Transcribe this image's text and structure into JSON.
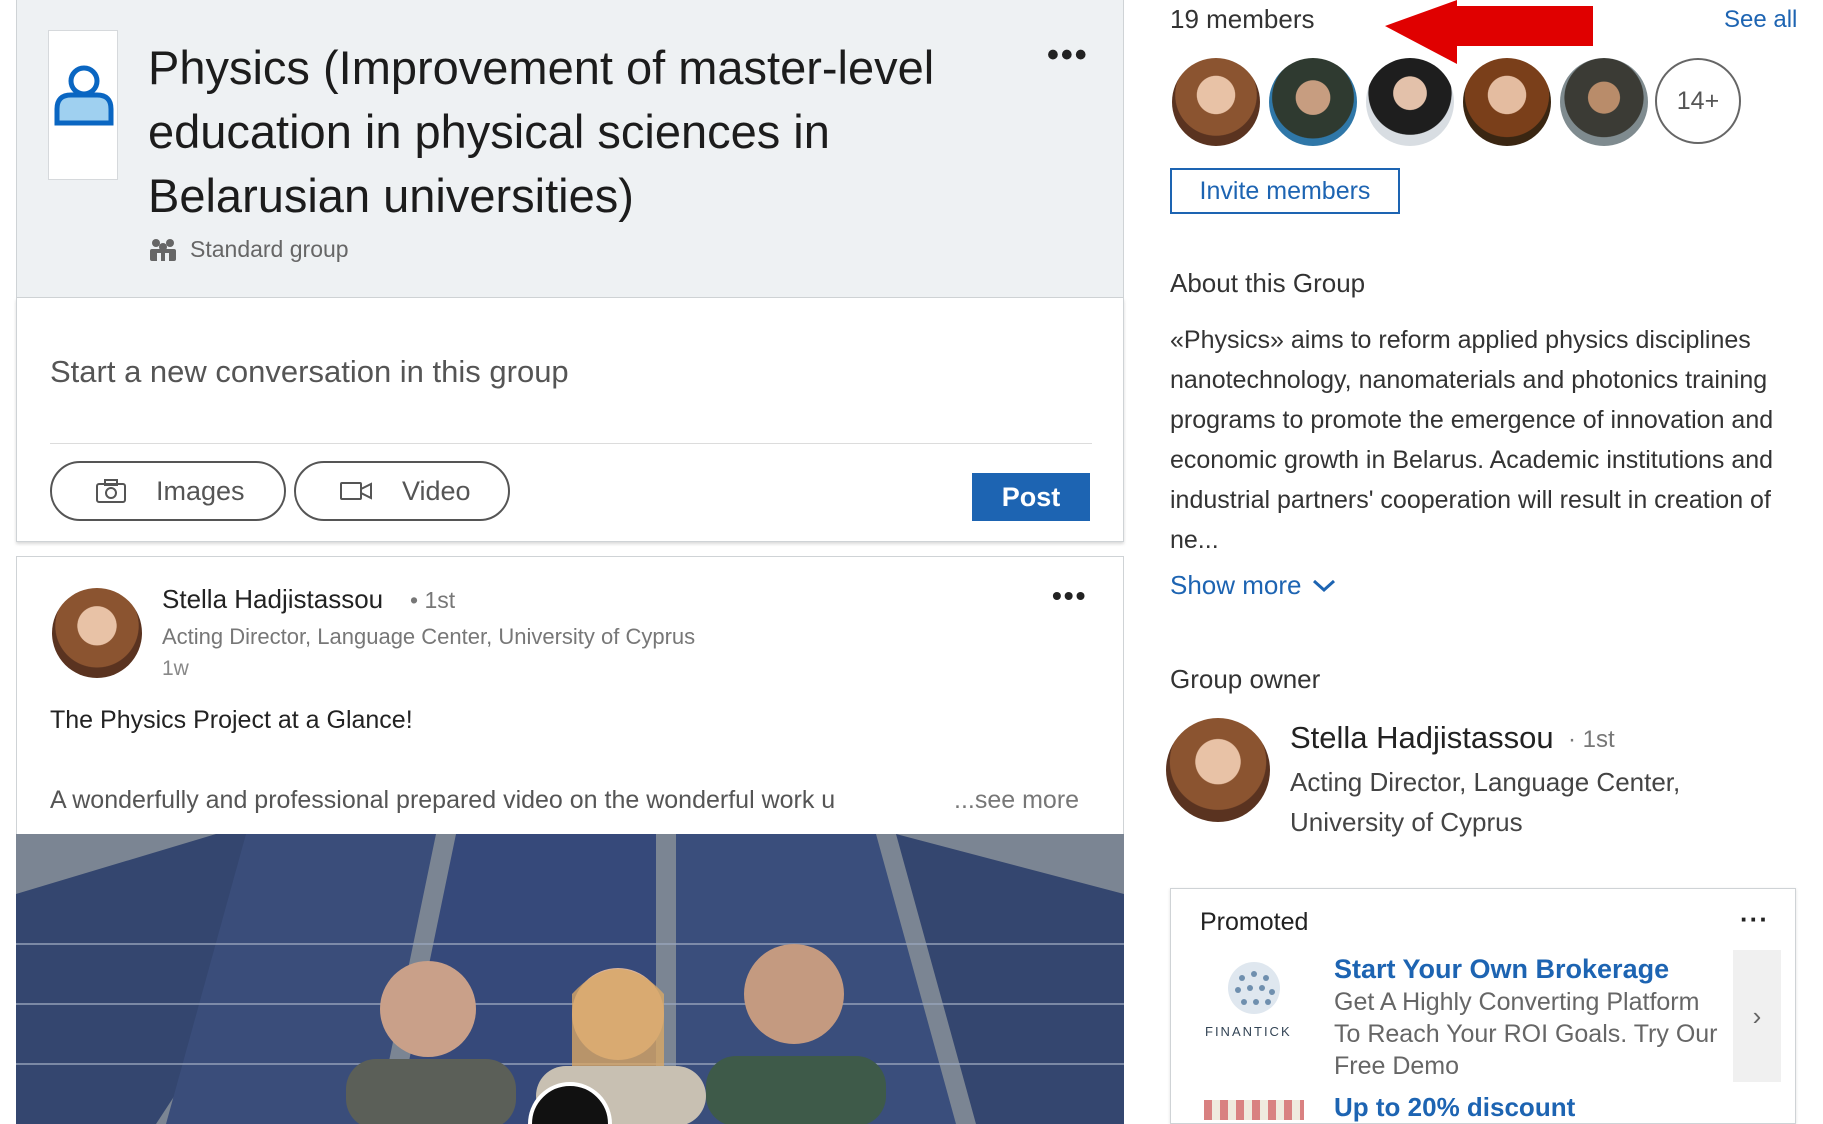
{
  "group": {
    "title": "Physics (Improvement of master-level education in physical sciences in Belarusian universities)",
    "type_label": "Standard group",
    "menu_icon": "more-dots-icon"
  },
  "composer": {
    "placeholder": "Start a new conversation in this group",
    "images_label": "Images",
    "video_label": "Video",
    "post_label": "Post"
  },
  "post": {
    "author_name": "Stella Hadjistassou",
    "author_degree": "• 1st",
    "author_headline": "Acting Director, Language Center, University of Cyprus",
    "time": "1w",
    "heading": "The Physics Project at a Glance!",
    "body": "A wonderfully and professional prepared video on the wonderful work u",
    "see_more": "...see more"
  },
  "members": {
    "count_label": "19 members",
    "see_all": "See all",
    "more_count": "14+",
    "invite_label": "Invite members"
  },
  "about": {
    "heading": "About this Group",
    "text": "«Physics» aims to reform applied physics disciplines nanotechnology, nanomaterials and photonics training programs to promote the emergence of innovation and economic growth in Belarus. Academic institutions and industrial partners' cooperation will result in creation of ne...",
    "show_more": "Show more"
  },
  "owner": {
    "heading": "Group owner",
    "name": "Stella Hadjistassou",
    "degree": "· 1st",
    "headline": "Acting Director, Language Center, University of Cyprus"
  },
  "promoted": {
    "label": "Promoted",
    "menu": "···",
    "ad1_title": "Start Your Own Brokerage",
    "ad1_desc": "Get A Highly Converting Platform To Reach Your ROI Goals. Try Our Free Demo",
    "ad1_logo_text": "FINANTICK",
    "ad2_title": "Up to 20% discount",
    "arrow": "›"
  },
  "colors": {
    "accent": "#1d64b2",
    "annotation_arrow": "#e00000"
  }
}
